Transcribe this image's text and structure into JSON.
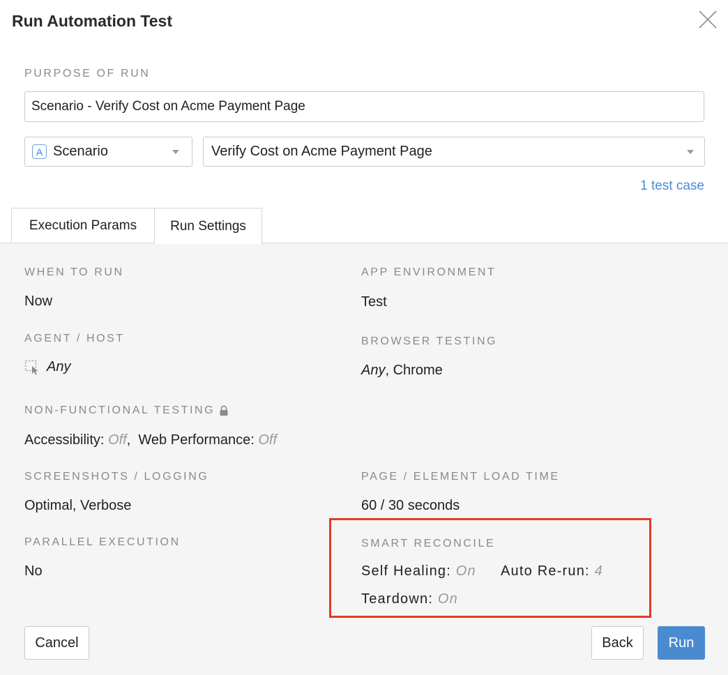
{
  "dialog": {
    "title": "Run Automation Test"
  },
  "purpose": {
    "label": "PURPOSE OF RUN",
    "value": "Scenario - Verify Cost on Acme Payment Page"
  },
  "type_select": {
    "badge": "A",
    "value": "Scenario"
  },
  "scenario_select": {
    "value": "Verify Cost on Acme Payment Page"
  },
  "test_case_link": "1 test case",
  "tabs": [
    {
      "label": "Execution Params"
    },
    {
      "label": "Run Settings"
    }
  ],
  "settings": {
    "when_to_run": {
      "label": "WHEN TO RUN",
      "value": "Now"
    },
    "app_environment": {
      "label": "APP ENVIRONMENT",
      "value": "Test"
    },
    "agent_host": {
      "label": "AGENT / HOST",
      "value": "Any"
    },
    "browser_testing": {
      "label": "BROWSER TESTING",
      "any": "Any",
      "separator": ",",
      "browser": "Chrome"
    },
    "non_functional": {
      "label": "NON-FUNCTIONAL TESTING",
      "accessibility_key": "Accessibility:",
      "accessibility_value": "Off",
      "separator": ",",
      "web_perf_key": "Web Performance:",
      "web_perf_value": "Off"
    },
    "screenshots_logging": {
      "label": "SCREENSHOTS / LOGGING",
      "value": "Optimal, Verbose"
    },
    "load_time": {
      "label": "PAGE / ELEMENT LOAD TIME",
      "value": "60 / 30 seconds"
    },
    "parallel_execution": {
      "label": "PARALLEL EXECUTION",
      "value": "No"
    },
    "smart_reconcile": {
      "label": "SMART RECONCILE",
      "self_healing_key": "Self Healing:",
      "self_healing_value": "On",
      "auto_rerun_key": "Auto Re-run:",
      "auto_rerun_value": "4",
      "teardown_key": "Teardown:",
      "teardown_value": "On"
    }
  },
  "buttons": {
    "cancel": "Cancel",
    "back": "Back",
    "run": "Run"
  },
  "colors": {
    "accent": "#4a8bd0",
    "highlight": "#e23b24"
  }
}
